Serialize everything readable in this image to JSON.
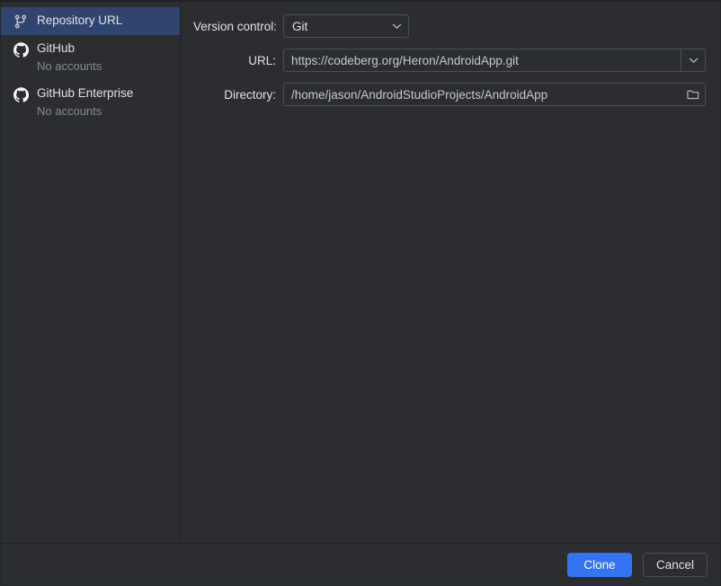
{
  "colors": {
    "accent": "#3574f0",
    "selection": "#2f4570",
    "background": "#2b2d30",
    "border": "#4b4f55",
    "text": "#dfe1e5",
    "muted": "#868a91"
  },
  "sidebar": {
    "items": [
      {
        "label": "Repository URL",
        "sub": "",
        "icon": "git-branch-icon",
        "selected": true
      },
      {
        "label": "GitHub",
        "sub": "No accounts",
        "icon": "github-icon",
        "selected": false
      },
      {
        "label": "GitHub Enterprise",
        "sub": "No accounts",
        "icon": "github-icon",
        "selected": false
      }
    ]
  },
  "main": {
    "version_control": {
      "label": "Version control:",
      "value": "Git",
      "options": [
        "Git"
      ]
    },
    "url": {
      "label": "URL:",
      "value": "https://codeberg.org/Heron/AndroidApp.git",
      "placeholder": ""
    },
    "directory": {
      "label": "Directory:",
      "value": "/home/jason/AndroidStudioProjects/AndroidApp",
      "placeholder": ""
    }
  },
  "footer": {
    "clone_label": "Clone",
    "cancel_label": "Cancel"
  }
}
